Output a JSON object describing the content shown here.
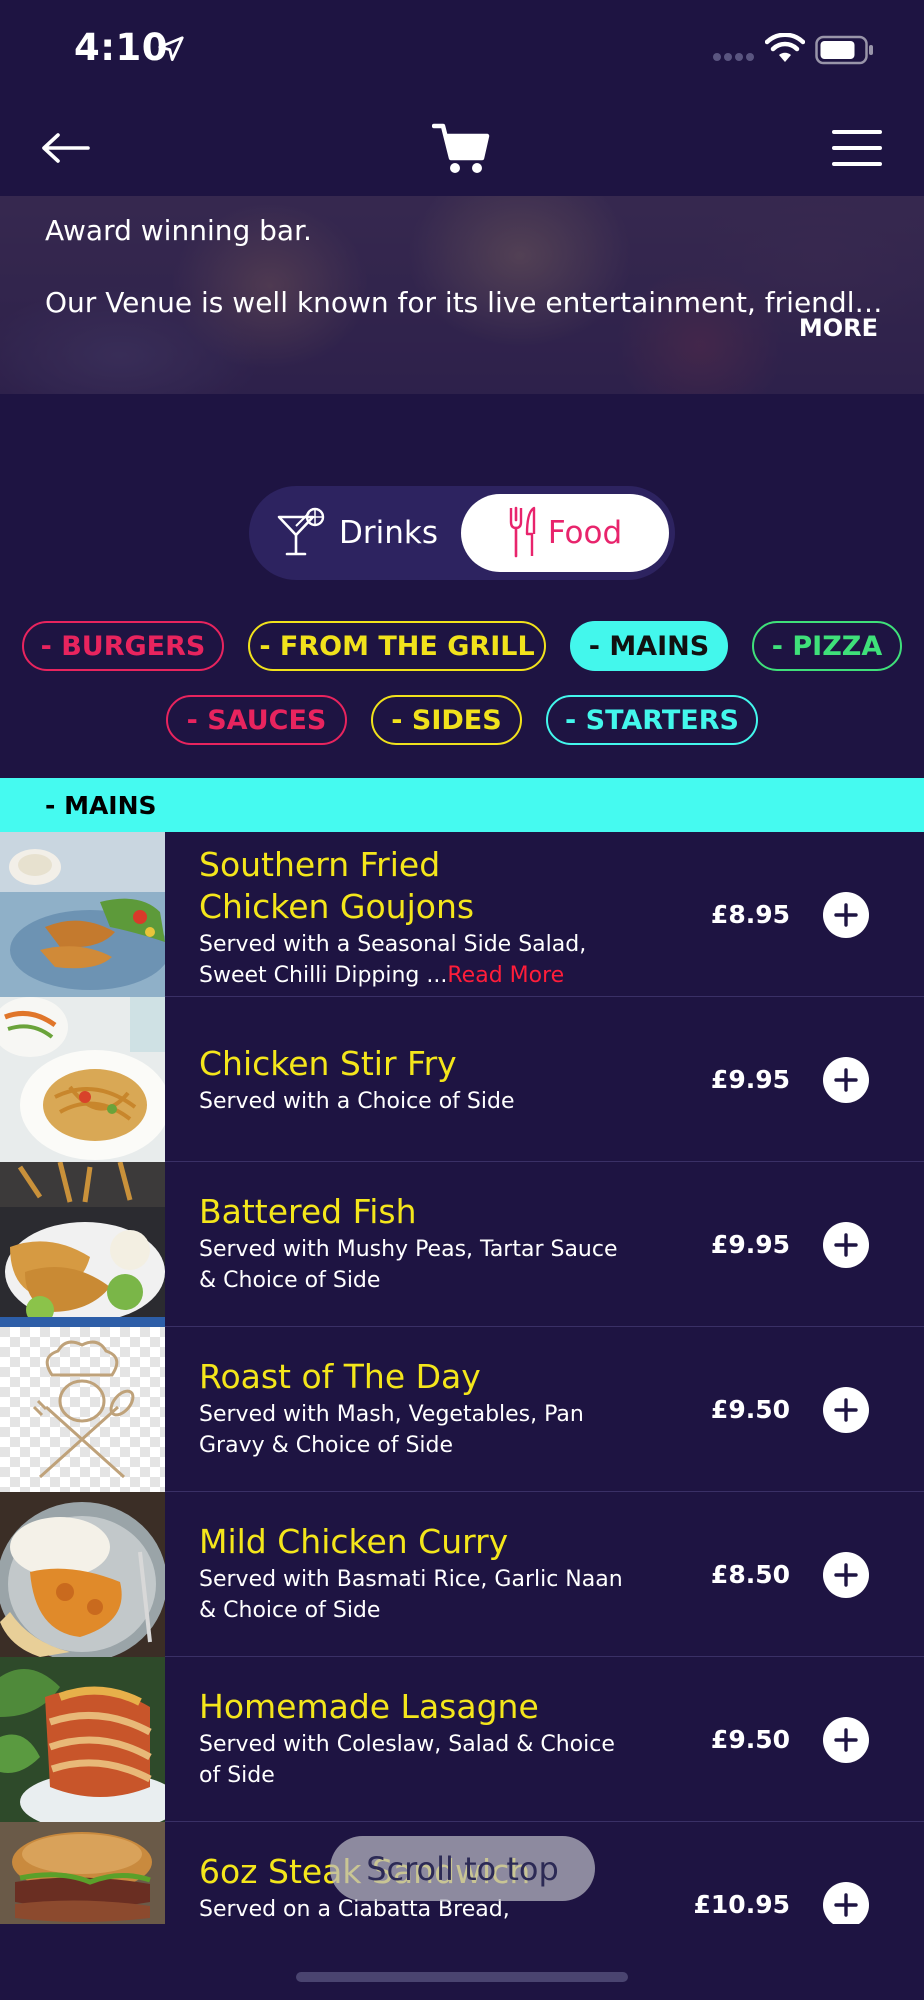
{
  "status_bar": {
    "time": "4:10"
  },
  "venue": {
    "line1": "Award winning bar.",
    "line2": "Our Venue is well known for its live entertainment, friendly...",
    "more_label": "MORE"
  },
  "toggle": {
    "drinks_label": "Drinks",
    "food_label": "Food",
    "selected": "Food"
  },
  "categories": [
    {
      "label": "- BURGERS",
      "color": "#e8245e"
    },
    {
      "label": "- FROM THE GRILL",
      "color": "#f1e21c"
    },
    {
      "label": "- MAINS",
      "color": "#43f7ec",
      "active": true
    },
    {
      "label": "- PIZZA",
      "color": "#3fe07a"
    },
    {
      "label": "- SAUCES",
      "color": "#e8245e"
    },
    {
      "label": "- SIDES",
      "color": "#f1e21c"
    },
    {
      "label": "- STARTERS",
      "color": "#43f7ec"
    }
  ],
  "section_title": "- MAINS",
  "items": [
    {
      "name_line1": "Southern Fried",
      "name_line2": "Chicken Goujons",
      "desc_line1": "Served with a Seasonal Side Salad,",
      "desc_line2": "Sweet Chilli Dipping ...",
      "read_more": "Read More",
      "price": "£8.95"
    },
    {
      "name_line1": "Chicken Stir Fry",
      "desc_line1": "Served with a Choice of Side",
      "price": "£9.95"
    },
    {
      "name_line1": "Battered Fish",
      "desc_line1": "Served with Mushy Peas, Tartar Sauce",
      "desc_line2": "& Choice of Side",
      "price": "£9.95"
    },
    {
      "name_line1": "Roast of The Day",
      "desc_line1": "Served with Mash, Vegetables, Pan",
      "desc_line2": "Gravy & Choice of Side",
      "price": "£9.50"
    },
    {
      "name_line1": "Mild Chicken Curry",
      "desc_line1": "Served with Basmati Rice, Garlic Naan",
      "desc_line2": "& Choice of Side",
      "price": "£8.50"
    },
    {
      "name_line1": "Homemade Lasagne",
      "desc_line1": "Served with Coleslaw, Salad & Choice",
      "desc_line2": "of Side",
      "price": "£9.50"
    },
    {
      "name_line1": "6oz Steak Sandwich",
      "desc_line1": "Served on a Ciabatta Bread,",
      "price": "£10.95"
    }
  ],
  "scroll_top_label": "Scroll to top",
  "colors": {
    "background": "#1e1442",
    "item_name": "#f4e61b",
    "accent_pink": "#e8246c",
    "section_header": "#45faf0",
    "read_more": "#ff1d3a"
  }
}
